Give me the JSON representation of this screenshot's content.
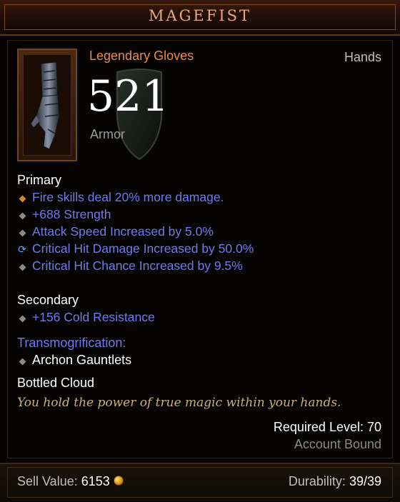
{
  "item": {
    "name": "MAGEFIST",
    "type": "Legendary Gloves",
    "slot": "Hands",
    "armor_value": "521",
    "armor_label": "Armor"
  },
  "primary": {
    "label": "Primary",
    "affixes": [
      {
        "text": "Fire skills deal 20% more damage.",
        "bullet": "orange-diamond"
      },
      {
        "text": "+688 Strength",
        "bullet": "grey-diamond"
      },
      {
        "text": "Attack Speed Increased by 5.0%",
        "bullet": "grey-diamond"
      },
      {
        "text": "Critical Hit Damage Increased by 50.0%",
        "bullet": "enchant-swirl"
      },
      {
        "text": "Critical Hit Chance Increased by 9.5%",
        "bullet": "grey-diamond"
      }
    ]
  },
  "secondary": {
    "label": "Secondary",
    "affixes": [
      {
        "text": "+156 Cold Resistance",
        "bullet": "grey-diamond"
      }
    ]
  },
  "transmog": {
    "label": "Transmogrification:",
    "item": "Archon Gauntlets"
  },
  "set_name": "Bottled Cloud",
  "flavor_text": "You hold the power of true magic within your hands.",
  "required_level": "Required Level: 70",
  "bound": "Account Bound",
  "footer": {
    "sell_label": "Sell Value:",
    "sell_value": "6153",
    "durability_label": "Durability:",
    "durability_value": "39/39"
  },
  "colors": {
    "legendary": "#e88a4a",
    "magic_affix": "#6f79f0",
    "flavor": "#c9b07a",
    "title": "#e9a97a"
  }
}
